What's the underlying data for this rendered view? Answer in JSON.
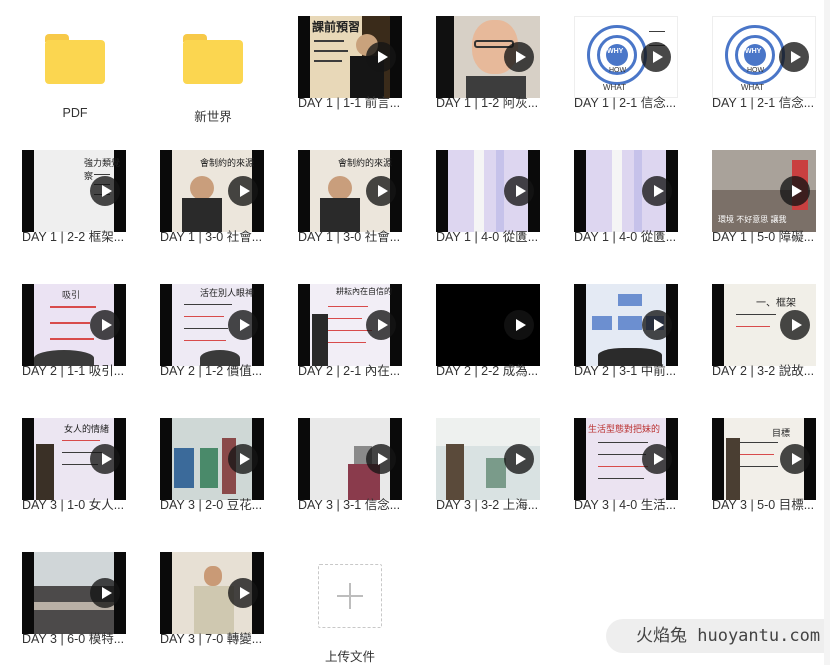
{
  "folders": [
    {
      "label": "PDF",
      "icon": "folder-icon"
    },
    {
      "label": "新世界",
      "icon": "folder-icon"
    }
  ],
  "videos": [
    "DAY 1 | 1-1 前言...",
    "DAY 1 | 1-2 阿灰...",
    "DAY 1 | 2-1 信念...",
    "DAY 1 | 2-1 信念...",
    "DAY 1 | 2-2 框架...",
    "DAY 1 | 3-0 社會...",
    "DAY 1 | 3-0 社會...",
    "DAY 1 | 4-0 從匱...",
    "DAY 1 | 4-0 從匱...",
    "DAY 1 | 5-0 障礙...",
    "DAY 2 | 1-1 吸引...",
    "DAY 2 | 1-2 價值...",
    "DAY 2 | 2-1 內在...",
    "DAY 2 | 2-2 成為...",
    "DAY 2 | 3-1 中前...",
    "DAY 2 | 3-2 說故...",
    "DAY 3 | 1-0 女人...",
    "DAY 3 | 2-0 豆花...",
    "DAY 3 | 3-1 信念...",
    "DAY 3 | 3-2 上海...",
    "DAY 3 | 4-0 生活...",
    "DAY 3 | 5-0 目標...",
    "DAY 3 | 6-0 模特...",
    "DAY 3 | 7-0 轉變..."
  ],
  "thumb_text": {
    "t1": "課前預習",
    "t4": "WHY",
    "t4b": "HOW",
    "t4c": "WHAT",
    "t5": "強力類覺察",
    "t6": "會制約的來源",
    "t11": "吸引",
    "t12": "活在別人眼神",
    "t13": "耕耘內在自信的",
    "t16": "一、框架",
    "t17": "女人的情緒",
    "t21": "生活型態對把妹的",
    "t22": "目標",
    "t10": "環境 不好意思 讓我"
  },
  "upload": {
    "label": "上传文件"
  },
  "watermark": {
    "text": "火焰兔 huoyantu.com"
  },
  "colors": {
    "folder": "#fbd650",
    "accent_red": "#d84b4b"
  }
}
